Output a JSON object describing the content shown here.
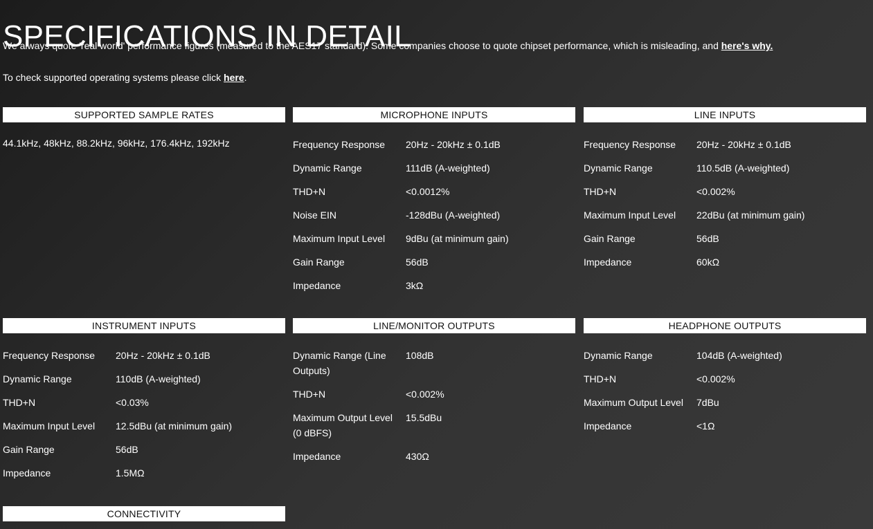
{
  "page": {
    "title": "SPECIFICATIONS IN DETAIL"
  },
  "intro": {
    "line1_text": "We always quote 'real world' performance figures (measured to the AES17 standard). Some companies choose to quote chipset performance, which is misleading, and ",
    "line1_link": "here's why.",
    "line2_text": "To check supported operating systems please click ",
    "line2_link": "here",
    "line2_suffix": "."
  },
  "sections": {
    "sample_rates": {
      "header": "SUPPORTED SAMPLE RATES",
      "text": "44.1kHz, 48kHz, 88.2kHz, 96kHz, 176.4kHz, 192kHz"
    },
    "microphone_inputs": {
      "header": "MICROPHONE INPUTS",
      "rows": [
        {
          "label": "Frequency Response",
          "value": "20Hz - 20kHz ± 0.1dB"
        },
        {
          "label": "Dynamic Range",
          "value": "111dB (A-weighted)"
        },
        {
          "label": "THD+N",
          "value": "<0.0012%"
        },
        {
          "label": "Noise EIN",
          "value": "-128dBu (A-weighted)"
        },
        {
          "label": "Maximum Input Level",
          "value": "9dBu (at minimum gain)"
        },
        {
          "label": "Gain Range",
          "value": "56dB"
        },
        {
          "label": "Impedance",
          "value": "3kΩ"
        }
      ]
    },
    "line_inputs": {
      "header": "LINE INPUTS",
      "rows": [
        {
          "label": "Frequency Response",
          "value": "20Hz - 20kHz ± 0.1dB"
        },
        {
          "label": "Dynamic Range",
          "value": "110.5dB (A-weighted)"
        },
        {
          "label": "THD+N",
          "value": "<0.002%"
        },
        {
          "label": "Maximum Input Level",
          "value": "22dBu (at minimum gain)"
        },
        {
          "label": "Gain Range",
          "value": "56dB"
        },
        {
          "label": "Impedance",
          "value": "60kΩ"
        }
      ]
    },
    "instrument_inputs": {
      "header": "INSTRUMENT INPUTS",
      "rows": [
        {
          "label": "Frequency Response",
          "value": "20Hz - 20kHz ± 0.1dB"
        },
        {
          "label": "Dynamic Range",
          "value": "110dB (A-weighted)"
        },
        {
          "label": "THD+N",
          "value": "<0.03%"
        },
        {
          "label": "Maximum Input Level",
          "value": "12.5dBu (at minimum gain)"
        },
        {
          "label": "Gain Range",
          "value": "56dB"
        },
        {
          "label": "Impedance",
          "value": "1.5MΩ"
        }
      ]
    },
    "line_monitor_outputs": {
      "header": "LINE/MONITOR OUTPUTS",
      "rows": [
        {
          "label": "Dynamic Range (Line Outputs)",
          "value": "108dB"
        },
        {
          "label": "THD+N",
          "value": "<0.002%"
        },
        {
          "label": "Maximum Output Level (0 dBFS)",
          "value": "15.5dBu"
        },
        {
          "label": "Impedance",
          "value": "430Ω"
        }
      ]
    },
    "headphone_outputs": {
      "header": "HEADPHONE OUTPUTS",
      "rows": [
        {
          "label": "Dynamic Range",
          "value": "104dB (A-weighted)"
        },
        {
          "label": "THD+N",
          "value": "<0.002%"
        },
        {
          "label": "Maximum Output Level",
          "value": "7dBu"
        },
        {
          "label": "Impedance",
          "value": "<1Ω"
        }
      ]
    },
    "connectivity": {
      "header": "CONNECTIVITY"
    }
  }
}
